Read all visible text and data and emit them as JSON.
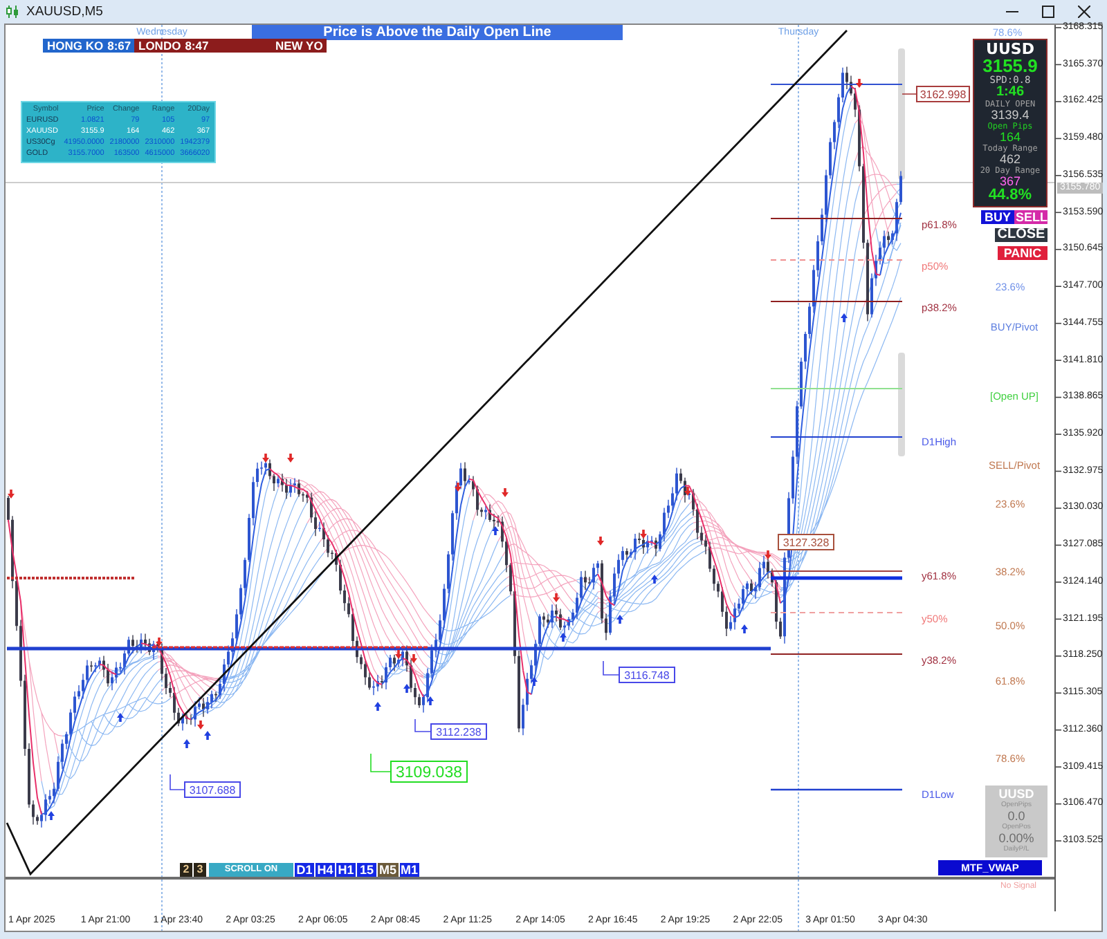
{
  "window": {
    "title": "XAUUSD,M5"
  },
  "day_labels": [
    "Wednesday",
    "Thursday"
  ],
  "banner": {
    "text": "Price is Above the Daily Open Line"
  },
  "sessions": [
    {
      "name": "HONG KO",
      "time": "8:67",
      "color": "#2266cc"
    },
    {
      "name": "LONDO",
      "time": "8:47",
      "color": "#8c1c1c"
    },
    {
      "name": "NEW YO",
      "color": "#8c1c1c"
    }
  ],
  "market_table": {
    "columns": [
      "Symbol",
      "Price",
      "Change",
      "Range",
      "20Day"
    ],
    "rows": [
      {
        "cells": [
          "EURUSD",
          "1.0821",
          "79",
          "105",
          "97"
        ],
        "selected": false
      },
      {
        "cells": [
          "XAUUSD",
          "3155.9",
          "164",
          "462",
          "367"
        ],
        "selected": true
      },
      {
        "cells": [
          "US30Cg",
          "41950.0000",
          "2180000",
          "2310000",
          "1942379"
        ],
        "selected": false
      },
      {
        "cells": [
          "GOLD",
          "3155.7000",
          "163500",
          "4615000",
          "3666020"
        ],
        "selected": false
      }
    ]
  },
  "info_panel": {
    "lines": [
      {
        "text": "UUSD",
        "kind": "symbol"
      },
      {
        "text": "3155.9",
        "kind": "price"
      },
      {
        "text": "SPD:0.8",
        "kind": "spread"
      },
      {
        "text": "1:46",
        "kind": "timer"
      },
      {
        "text": "DAILY OPEN",
        "kind": "label"
      },
      {
        "text": "3139.4",
        "kind": "value"
      },
      {
        "text": "Open Pips",
        "kind": "pips_label"
      },
      {
        "text": "164",
        "kind": "pips"
      },
      {
        "text": "Today Range",
        "kind": "label"
      },
      {
        "text": "462",
        "kind": "value"
      },
      {
        "text": "20 Day Range",
        "kind": "label"
      },
      {
        "text": "367",
        "kind": "range20"
      },
      {
        "text": "44.8%",
        "kind": "percent"
      }
    ]
  },
  "trade_buttons": [
    {
      "label": "BUY",
      "kind": "buy"
    },
    {
      "label": "SELL",
      "kind": "sell"
    },
    {
      "label": "CLOSE",
      "kind": "close"
    },
    {
      "label": "PANIC",
      "kind": "panic"
    }
  ],
  "price_tags": [
    {
      "text": "3162.998",
      "color": "#a83c3c"
    },
    {
      "text": "3127.328",
      "color": "#a8503c"
    },
    {
      "text": "3116.748",
      "color": "#4848e8"
    },
    {
      "text": "3112.238",
      "color": "#4848e8"
    },
    {
      "text": "3109.038",
      "color": "#22dd22"
    },
    {
      "text": "3107.688",
      "color": "#4848e8"
    }
  ],
  "pivot_levels": [
    {
      "text": "p61.8%",
      "color": "#a03040"
    },
    {
      "text": "p50%",
      "color": "#f07878"
    },
    {
      "text": "p38.2%",
      "color": "#a03040"
    },
    {
      "text": "D1High",
      "color": "#4a5ae8"
    },
    {
      "text": "y61.8%",
      "color": "#a03040"
    },
    {
      "text": "y50%",
      "color": "#f07878"
    },
    {
      "text": "y38.2%",
      "color": "#a03040"
    },
    {
      "text": "D1Low",
      "color": "#4a5ae8"
    }
  ],
  "fib_levels": [
    {
      "text": "78.6%",
      "color": "#7ea6f0"
    },
    {
      "text": "23.6%",
      "color": "#6f90e8"
    },
    {
      "text": "BUY/Pivot",
      "color": "#5f80e0"
    },
    {
      "text": "[Open UP]",
      "color": "#40d040"
    },
    {
      "text": "SELL/Pivot",
      "color": "#c07850"
    },
    {
      "text": "23.6%",
      "color": "#c07850"
    },
    {
      "text": "38.2%",
      "color": "#c07850"
    },
    {
      "text": "50.0%",
      "color": "#c07850"
    },
    {
      "text": "61.8%",
      "color": "#c07850"
    },
    {
      "text": "78.6%",
      "color": "#c07850"
    }
  ],
  "chart_controls": {
    "pages": [
      "2",
      "3"
    ],
    "scroll": "SCROLL ON",
    "timeframes": [
      {
        "label": "D1",
        "selected": false
      },
      {
        "label": "H4",
        "selected": false
      },
      {
        "label": "H1",
        "selected": false
      },
      {
        "label": "15",
        "selected": false
      },
      {
        "label": "M5",
        "selected": true
      },
      {
        "label": "M1",
        "selected": false
      }
    ]
  },
  "position_panel": {
    "items": [
      {
        "text": "UUSD",
        "kind": "symbol"
      },
      {
        "text": "OpenPips",
        "kind": "label"
      },
      {
        "text": "0.0",
        "kind": "value"
      },
      {
        "text": "OpenPos",
        "kind": "label"
      },
      {
        "text": "0.00%",
        "kind": "value"
      },
      {
        "text": "DailyP/L",
        "kind": "label"
      }
    ]
  },
  "vwap_button": {
    "label": "MTF_VWAP"
  },
  "subwindow": {
    "status": "No Signal"
  },
  "price_axis": {
    "ticks": [
      "3168.315",
      "3165.370",
      "3162.425",
      "3159.480",
      "3156.535",
      "3153.590",
      "3150.645",
      "3147.700",
      "3144.755",
      "3141.810",
      "3138.865",
      "3135.920",
      "3132.975",
      "3130.030",
      "3127.085",
      "3124.140",
      "3121.195",
      "3118.250",
      "3115.305",
      "3112.360",
      "3109.415",
      "3106.470",
      "3103.525"
    ],
    "current": "3155.780"
  },
  "time_axis": [
    "1 Apr 2025",
    "1 Apr 21:00",
    "1 Apr 23:40",
    "2 Apr 03:25",
    "2 Apr 06:05",
    "2 Apr 08:45",
    "2 Apr 11:25",
    "2 Apr 14:05",
    "2 Apr 16:45",
    "2 Apr 19:25",
    "2 Apr 22:05",
    "3 Apr 01:50",
    "3 Apr 04:30"
  ]
}
